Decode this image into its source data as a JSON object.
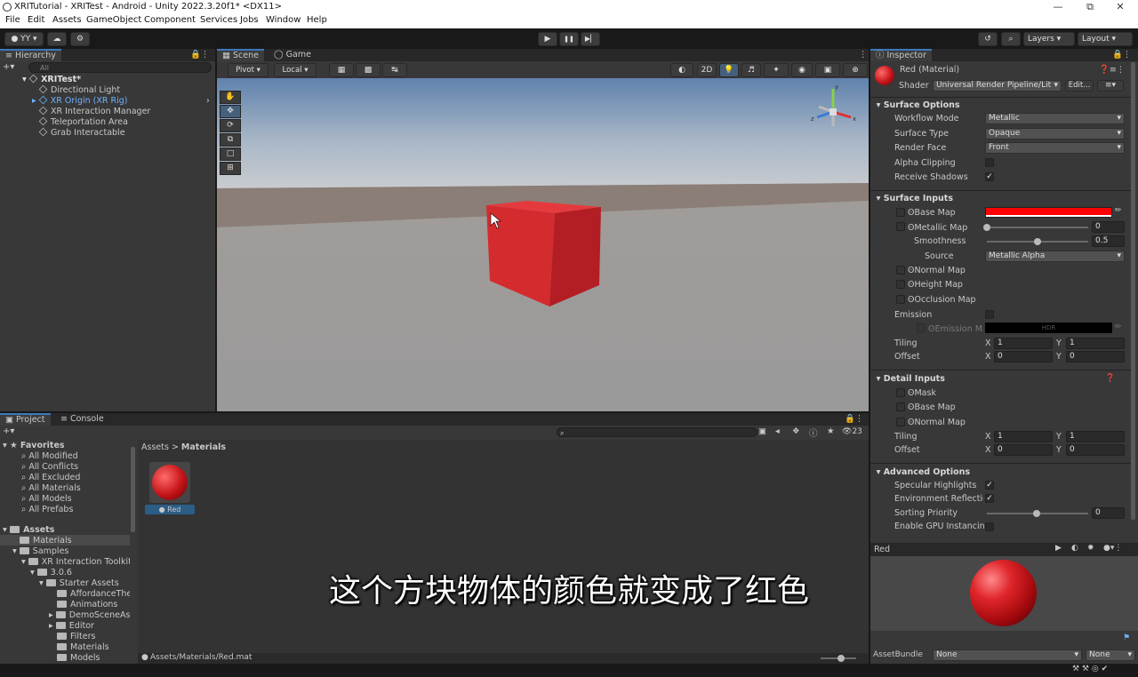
{
  "window": {
    "title": "XRITutorial - XRITest - Android - Unity 2022.3.20f1* <DX11>",
    "min": "—",
    "max": "⧉",
    "close": "✕"
  },
  "menu": [
    "File",
    "Edit",
    "Assets",
    "GameObject",
    "Component",
    "Services",
    "Jobs",
    "Window",
    "Help"
  ],
  "toolbar": {
    "account": "YY",
    "layers": "Layers",
    "layout": "Layout",
    "play": "▶",
    "pause": "❚❚",
    "step": "▶▏"
  },
  "hierarchy": {
    "tab": "Hierarchy",
    "search_placeholder": "All",
    "scene": "XRITest*",
    "items": [
      "Directional Light",
      "XR Origin (XR Rig)",
      "XR Interaction Manager",
      "Teleportation Area",
      "Grab Interactable"
    ]
  },
  "scene": {
    "tabs": [
      "Scene",
      "Game"
    ],
    "pivot": "Pivot",
    "local": "Local",
    "mode2d": "2D",
    "gizmo_labels": [
      "y",
      "x",
      "z"
    ]
  },
  "project": {
    "tabs": [
      "Project",
      "Console"
    ],
    "favorites_label": "Favorites",
    "favorites": [
      "All Modified",
      "All Conflicts",
      "All Excluded",
      "All Materials",
      "All Models",
      "All Prefabs"
    ],
    "assets_label": "Assets",
    "tree": [
      "Materials",
      "Samples",
      "XR Interaction Toolkit",
      "3.0.6",
      "Starter Assets",
      "AffordanceThen",
      "Animations",
      "DemoSceneAss",
      "Editor",
      "Filters",
      "Materials",
      "Models"
    ],
    "breadcrumb": [
      "Assets",
      "Materials"
    ],
    "asset_name": "Red",
    "path": "Assets/Materials/Red.mat",
    "count": "23"
  },
  "subtitle": "这个方块物体的颜色就变成了红色",
  "inspector": {
    "tab": "Inspector",
    "material_name": "Red (Material)",
    "shader_label": "Shader",
    "shader_value": "Universal Render Pipeline/Lit",
    "edit": "Edit...",
    "surface_options": "Surface Options",
    "workflow_mode_label": "Workflow Mode",
    "workflow_mode": "Metallic",
    "surface_type_label": "Surface Type",
    "surface_type": "Opaque",
    "render_face_label": "Render Face",
    "render_face": "Front",
    "alpha_clipping": "Alpha Clipping",
    "receive_shadows": "Receive Shadows",
    "surface_inputs": "Surface Inputs",
    "base_map": "Base Map",
    "metallic_map": "Metallic Map",
    "metallic_value": "0",
    "smoothness": "Smoothness",
    "smoothness_value": "0.5",
    "source_label": "Source",
    "source": "Metallic Alpha",
    "normal_map": "Normal Map",
    "height_map": "Height Map",
    "occlusion_map": "Occlusion Map",
    "emission": "Emission",
    "emission_map": "Emission Map",
    "hdr": "HDR",
    "tiling": "Tiling",
    "offset": "Offset",
    "x": "X",
    "y": "Y",
    "tiling_x": "1",
    "tiling_y": "1",
    "offset_x": "0",
    "offset_y": "0",
    "detail_inputs": "Detail Inputs",
    "mask": "Mask",
    "detail_base_map": "Base Map",
    "detail_normal_map": "Normal Map",
    "detail_tiling_x": "1",
    "detail_tiling_y": "1",
    "detail_offset_x": "0",
    "detail_offset_y": "0",
    "advanced_options": "Advanced Options",
    "specular_highlights": "Specular Highlights",
    "environment_reflections": "Environment Reflection",
    "sorting_priority": "Sorting Priority",
    "sorting_priority_value": "0",
    "gpu_instancing": "Enable GPU Instancing",
    "preview_title": "Red",
    "assetbundle_label": "AssetBundle",
    "assetbundle": "None",
    "assetbundle_variant": "None"
  },
  "colors": {
    "base_color": "#ff0000",
    "cube_front": "#d42b2f",
    "cube_top": "#e43a3e",
    "cube_side": "#b21e23",
    "accent": "#3a79bb"
  }
}
